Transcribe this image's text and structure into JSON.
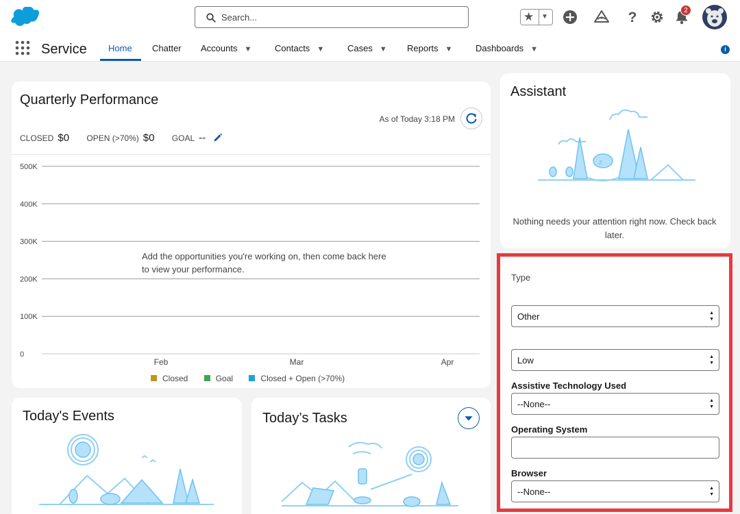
{
  "header": {
    "search_placeholder": "Search...",
    "notification_count": "2",
    "icons": [
      "salesforce-cloud-logo",
      "favorites-star-icon",
      "add-icon",
      "trailhead-icon",
      "help-icon",
      "setup-gear-icon",
      "notifications-bell-icon",
      "avatar"
    ]
  },
  "nav": {
    "app_name": "Service",
    "items": [
      {
        "label": "Home",
        "active": true,
        "has_menu": false
      },
      {
        "label": "Chatter",
        "active": false,
        "has_menu": false
      },
      {
        "label": "Accounts",
        "active": false,
        "has_menu": true
      },
      {
        "label": "Contacts",
        "active": false,
        "has_menu": true
      },
      {
        "label": "Cases",
        "active": false,
        "has_menu": true
      },
      {
        "label": "Reports",
        "active": false,
        "has_menu": true
      },
      {
        "label": "Dashboards",
        "active": false,
        "has_menu": true
      }
    ]
  },
  "performance": {
    "title": "Quarterly Performance",
    "as_of": "As of Today 3:18 PM",
    "closed_label": "CLOSED",
    "closed_value": "$0",
    "open_label": "OPEN (>70%)",
    "open_value": "$0",
    "goal_label": "GOAL",
    "goal_value": "--",
    "empty_message": "Add the opportunities you're working on, then come back here to view your performance.",
    "legend": [
      {
        "label": "Closed",
        "color": "#c4951b"
      },
      {
        "label": "Goal",
        "color": "#3ba755"
      },
      {
        "label": "Closed + Open (>70%)",
        "color": "#1ea1d9"
      }
    ]
  },
  "chart_data": {
    "type": "line",
    "y_tick_labels": [
      "500K",
      "400K",
      "300K",
      "200K",
      "100K",
      "0"
    ],
    "y_values": [
      500000,
      400000,
      300000,
      200000,
      100000,
      0
    ],
    "x_tick_labels": [
      "Feb",
      "Mar",
      "Apr"
    ],
    "ylim": [
      0,
      500000
    ],
    "series": [],
    "grid": true
  },
  "assistant": {
    "title": "Assistant",
    "message": "Nothing needs your attention right now. Check back later."
  },
  "case_form": {
    "type_label": "Type",
    "type_value": "Other",
    "priority_value": "Low",
    "assistive_label": "Assistive Technology Used",
    "assistive_value": "--None--",
    "os_label": "Operating System",
    "os_value": "",
    "browser_label": "Browser",
    "browser_value": "--None--"
  },
  "events": {
    "title": "Today's Events"
  },
  "tasks": {
    "title": "Today’s Tasks"
  }
}
